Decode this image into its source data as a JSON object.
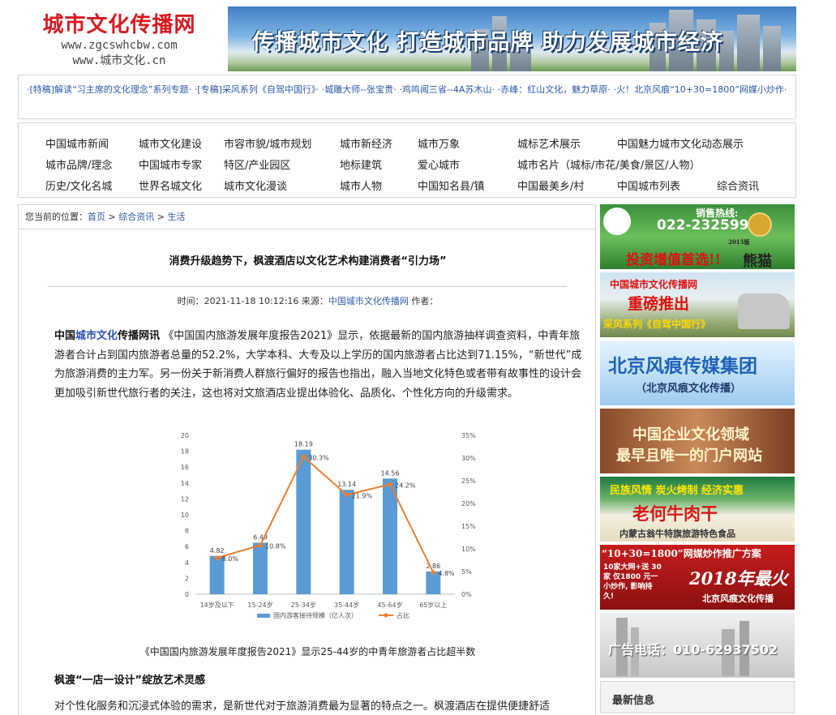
{
  "header": {
    "site_name": "城市文化传播网",
    "url_1": "www.zgcswhcbw.com",
    "url_2": "www.城市文化.cn",
    "banner_slogan": "传播城市文化  打造城市品牌  助力发展城市经济"
  },
  "ticker": {
    "items": [
      "·[特稿]解读“习主席的文化理念”系列专题·",
      "·[专稿]采风系列《自驾中国行》·",
      "·城雕大师--张宝贵·",
      "·鸡鸣闻三省--4A苏木山·",
      "·赤峰：红山文化，魅力草原·",
      "·火！北京风痕“10+30=1800”网媒小炒作·"
    ]
  },
  "nav": {
    "items": [
      "中国城市新闻",
      "城市文化建设",
      "市容市貌/城市规划",
      "城市新经济",
      "城市万象",
      "城标艺术展示",
      "中国魅力城市文化动态展示",
      "城市品牌/理念",
      "中国城市专家",
      "特区/产业园区",
      "地标建筑",
      "爱心城市",
      "城市名片（城标/市花/美食/景区/人物）",
      "历史/文化名城",
      "世界名城文化",
      "城市文化漫谈",
      "城市人物",
      "中国知名县/镇",
      "中国最美乡/村",
      "中国城市列表",
      "综合资讯"
    ]
  },
  "breadcrumb": {
    "prefix": "您当前的位置：",
    "home": "首页",
    "sep": " > ",
    "category": "综合资讯",
    "current": "生活"
  },
  "article": {
    "title": "消费升级趋势下，枫渡酒店以文化艺术构建消费者“引力场”",
    "meta_time_label": "时间：",
    "meta_time": "2021-11-18 10:12:16",
    "meta_source_label": "来源：",
    "meta_source": "中国城市文化传播网",
    "meta_author_label": "作者：",
    "lead_1": "中国",
    "lead_hl": "城市文化",
    "lead_2": "传播网讯",
    "para1": "《中国国内旅游发展年度报告2021》显示，依据最新的国内旅游抽样调查资料，中青年旅游者合计占到国内旅游者总量的52.2%，大学本科、大专及以上学历的国内旅游者占比达到71.15%，“新世代”成为旅游消费的主力军。另一份关于新消费人群旅行偏好的报告也指出，融入当地文化特色或者带有故事性的设计会更加吸引新世代旅行者的关注，这也将对文旅酒店业提出体验化、品质化、个性化方向的升级需求。",
    "caption": "《中国国内旅游发展年度报告2021》显示25-44岁的中青年旅游者占比超半数",
    "subheading": "枫渡“一店一设计”绽放艺术灵感",
    "para2": "对个性化服务和沉浸式体验的需求，是新世代对于旅游消费最为显著的特点之一。枫渡酒店在提供便捷舒适"
  },
  "chart_data": {
    "type": "bar",
    "categories": [
      "14岁及以下",
      "15-24岁",
      "25-34岁",
      "35-44岁",
      "45-64岁",
      "65岁以上"
    ],
    "series": [
      {
        "name": "国内游客接待规模（亿人次）",
        "type": "bar",
        "axis": "left",
        "values": [
          4.82,
          6.49,
          18.19,
          13.14,
          14.56,
          2.86
        ],
        "labels": [
          "4.82",
          "6.49",
          "18.19",
          "13.14",
          "14.56",
          "2.86"
        ]
      },
      {
        "name": "占比",
        "type": "line",
        "axis": "right",
        "values": [
          8.0,
          10.8,
          30.3,
          21.9,
          24.2,
          4.8
        ],
        "labels": [
          "8.0%",
          "10.8%",
          "30.3%",
          "21.9%",
          "24.2%",
          "4.8%"
        ]
      }
    ],
    "ylim_left": [
      0,
      20
    ],
    "ylim_right": [
      0,
      35
    ],
    "yticks_left": [
      "0",
      "2",
      "4",
      "6",
      "8",
      "10",
      "12",
      "14",
      "16",
      "18",
      "20"
    ],
    "yticks_right": [
      "0%",
      "5%",
      "10%",
      "15%",
      "20%",
      "25%",
      "30%",
      "35%"
    ],
    "legend_position": "bottom",
    "grid": false,
    "colors": {
      "bar": "#5b9bd5",
      "line": "#ed7d31"
    }
  },
  "sidebar": {
    "ad1_phone": "022-23259917",
    "ad1_hotline": "销售热线:",
    "ad1_slogan": "投资增值首选!!",
    "ad1_brand": "熊猫",
    "ad1_year": "2015版",
    "ad2_top": "中国城市文化传播网",
    "ad2_mid": "重磅推出",
    "ad2_bottom": "采风系列《自驾中国行》",
    "ad3_title": "北京风痕传媒集团",
    "ad3_sub": "（北京风痕文化传播）",
    "ad4_line1": "中国企业文化领域",
    "ad4_line2": "最早且唯一的门户网站",
    "ad5_top": "民族风情  炭火烤制  经济实惠",
    "ad5_mid": "老何牛肉干",
    "ad5_bottom": "内蒙古翁牛特旗旅游特色食品",
    "ad6_top": "“10+30=1800”网媒炒作推广方案",
    "ad6_mid": "10家大网+送 30家 仅1800 元一小炒作, 影响持久!",
    "ad6_big": "2018年最火",
    "ad6_bottom": "北京风痕文化传播",
    "ad7_text": "广告电话：010-62937502",
    "latest_title": "最新信息"
  }
}
